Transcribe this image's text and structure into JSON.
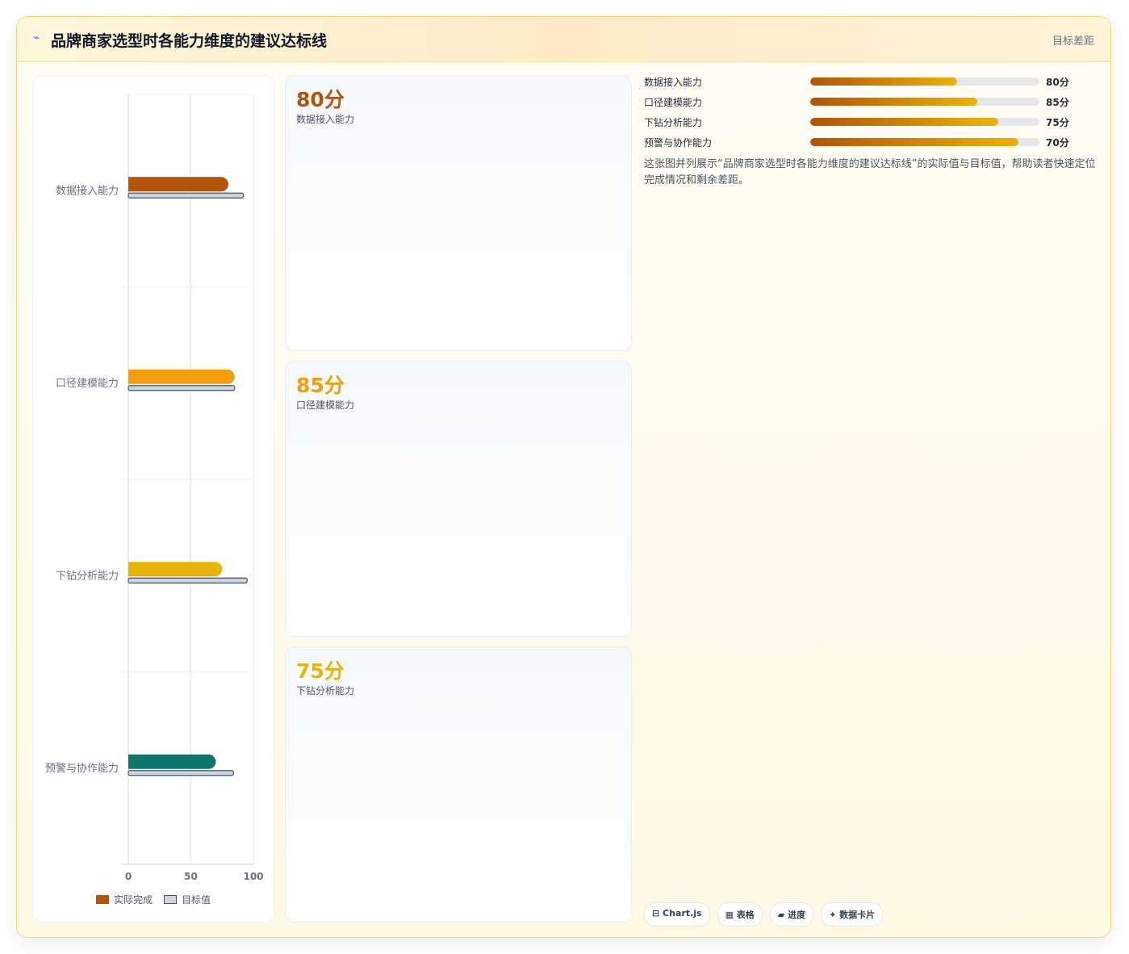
{
  "header": {
    "icon": "⌁",
    "title": "品牌商家选型时各能力维度的建议达标线",
    "right_label": "目标差距"
  },
  "chart_data": {
    "type": "bar",
    "orientation": "horizontal",
    "categories": [
      "数据接入能力",
      "口径建模能力",
      "下钻分析能力",
      "预警与协作能力"
    ],
    "series": [
      {
        "name": "实际完成",
        "values": [
          80,
          85,
          75,
          70
        ]
      },
      {
        "name": "目标值",
        "values": [
          92,
          85,
          95,
          84
        ]
      }
    ],
    "bar_colors": [
      "#b45309",
      "#f59e0b",
      "#eab308",
      "#0f766e"
    ],
    "target_color": "#cbd5e1",
    "xlim": [
      0,
      100
    ],
    "xticks": [
      "0",
      "50",
      "100"
    ],
    "grid": true,
    "legend_position": "bottom"
  },
  "cards": [
    {
      "value": "80分",
      "label": "数据接入能力",
      "color": "#b45309"
    },
    {
      "value": "85分",
      "label": "口径建模能力",
      "color": "#f59e0b"
    },
    {
      "value": "75分",
      "label": "下钻分析能力",
      "color": "#eab308"
    }
  ],
  "progress": [
    {
      "name": "数据接入能力",
      "pct": "80分",
      "fraction": 0.64
    },
    {
      "name": "口径建模能力",
      "pct": "85分",
      "fraction": 0.73
    },
    {
      "name": "下钻分析能力",
      "pct": "75分",
      "fraction": 0.82
    },
    {
      "name": "预警与协作能力",
      "pct": "70分",
      "fraction": 0.91
    }
  ],
  "description": "这张图并列展示“品牌商家选型时各能力维度的建议达标线”的实际值与目标值，帮助读者快速定位完成情况和剩余差距。",
  "tags": [
    "⊟ Chart.js",
    "▦ 表格",
    "▰ 进度",
    "✦ 数据卡片"
  ]
}
